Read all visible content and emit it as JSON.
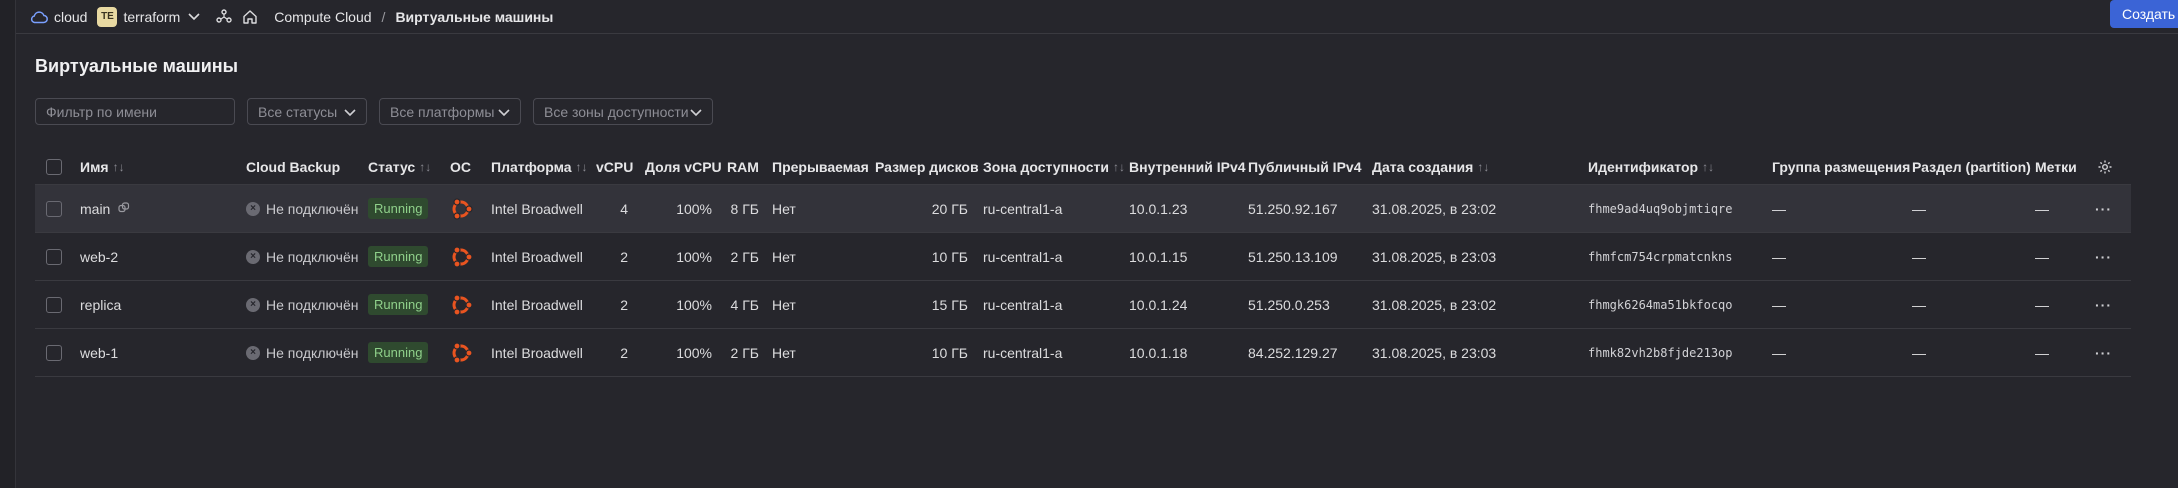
{
  "breadcrumbs": {
    "cloud": "cloud",
    "folder_badge": "TE",
    "folder": "terraform",
    "service": "Compute Cloud",
    "separator": "/",
    "current": "Виртуальные машины"
  },
  "create_button": "Создать в",
  "page_title": "Виртуальные машины",
  "filters": {
    "name_placeholder": "Фильтр по имени",
    "statuses": "Все статусы",
    "platforms": "Все платформы",
    "zones": "Все зоны доступности"
  },
  "columns": {
    "name": "Имя",
    "backup": "Cloud Backup",
    "status": "Статус",
    "os": "ОС",
    "platform": "Платформа",
    "vcpu": "vCPU",
    "vcpu_share": "Доля vCPU",
    "ram": "RAM",
    "preemptible": "Прерываемая",
    "disk_size": "Размер дисков",
    "zone": "Зона доступности",
    "internal_ip": "Внутренний IPv4",
    "public_ip": "Публичный IPv4",
    "created": "Дата создания",
    "id": "Идентификатор",
    "placement_group": "Группа размещения",
    "partition": "Раздел (partition)",
    "labels": "Метки"
  },
  "sort_glyph": "↑↓",
  "rows": [
    {
      "name": "main",
      "backup": "Не подключён",
      "status": "Running",
      "platform": "Intel Broadwell",
      "vcpu": "4",
      "vcpu_share": "100%",
      "ram": "8 ГБ",
      "preemptible": "Нет",
      "disk_size": "20 ГБ",
      "zone": "ru-central1-a",
      "internal_ip": "10.0.1.23",
      "public_ip": "51.250.92.167",
      "created": "31.08.2025, в 23:02",
      "id": "fhme9ad4uq9objmtiqre",
      "placement_group": "—",
      "partition": "—",
      "labels": "—"
    },
    {
      "name": "web-2",
      "backup": "Не подключён",
      "status": "Running",
      "platform": "Intel Broadwell",
      "vcpu": "2",
      "vcpu_share": "100%",
      "ram": "2 ГБ",
      "preemptible": "Нет",
      "disk_size": "10 ГБ",
      "zone": "ru-central1-a",
      "internal_ip": "10.0.1.15",
      "public_ip": "51.250.13.109",
      "created": "31.08.2025, в 23:03",
      "id": "fhmfcm754crpmatcnkns",
      "placement_group": "—",
      "partition": "—",
      "labels": "—"
    },
    {
      "name": "replica",
      "backup": "Не подключён",
      "status": "Running",
      "platform": "Intel Broadwell",
      "vcpu": "2",
      "vcpu_share": "100%",
      "ram": "4 ГБ",
      "preemptible": "Нет",
      "disk_size": "15 ГБ",
      "zone": "ru-central1-a",
      "internal_ip": "10.0.1.24",
      "public_ip": "51.250.0.253",
      "created": "31.08.2025, в 23:02",
      "id": "fhmgk6264ma51bkfocqo",
      "placement_group": "—",
      "partition": "—",
      "labels": "—"
    },
    {
      "name": "web-1",
      "backup": "Не подключён",
      "status": "Running",
      "platform": "Intel Broadwell",
      "vcpu": "2",
      "vcpu_share": "100%",
      "ram": "2 ГБ",
      "preemptible": "Нет",
      "disk_size": "10 ГБ",
      "zone": "ru-central1-a",
      "internal_ip": "10.0.1.18",
      "public_ip": "84.252.129.27",
      "created": "31.08.2025, в 23:03",
      "id": "fhmk82vh2b8fjde213op",
      "placement_group": "—",
      "partition": "—",
      "labels": "—"
    }
  ],
  "icons": {
    "cloud": "cloud-icon",
    "chevron": "chevron-down-icon",
    "services": "services-icon",
    "home": "home-icon",
    "copy": "copy-icon",
    "os": "ubuntu-icon",
    "settings": "gear-icon",
    "more": "more-icon",
    "backup_off": "backup-off-icon"
  },
  "colors": {
    "accent": "#3b64d6",
    "status_running": "#8fd08a",
    "os_ubuntu": "#e95420"
  }
}
